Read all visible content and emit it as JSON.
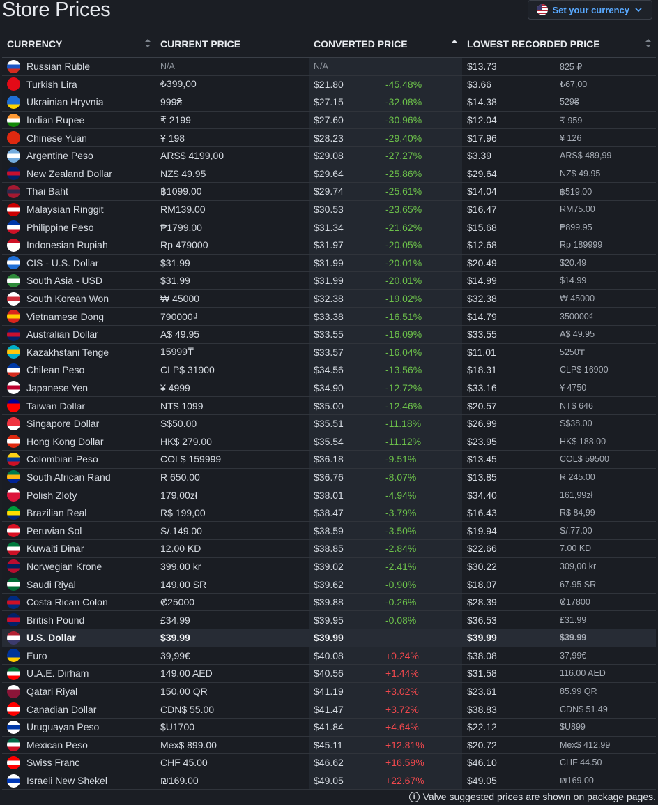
{
  "page": {
    "title": "Store Prices"
  },
  "currency_button": {
    "label": "Set your currency",
    "icon": "us-flag-icon"
  },
  "table": {
    "headers": [
      "CURRENCY",
      "CURRENT PRICE",
      "CONVERTED PRICE",
      "LOWEST RECORDED PRICE"
    ],
    "rows": [
      {
        "currency": "Russian Ruble",
        "current": "N/A",
        "converted": "N/A",
        "diff": "",
        "lowest": "$13.73",
        "lowest_local": "825 ₽",
        "flag": [
          "#ffffff",
          "#1c57c4",
          "#d52b1e"
        ]
      },
      {
        "currency": "Turkish Lira",
        "current": "₺399,00",
        "converted": "$21.80",
        "diff": "-45.48%",
        "lowest": "$3.66",
        "lowest_local": "₺67,00",
        "flag": [
          "#e30a17",
          "#e30a17",
          "#e30a17"
        ]
      },
      {
        "currency": "Ukrainian Hryvnia",
        "current": "999₴",
        "converted": "$27.15",
        "diff": "-32.08%",
        "lowest": "$14.38",
        "lowest_local": "529₴",
        "flag": [
          "#1f6fd6",
          "#1f6fd6",
          "#ffd500"
        ]
      },
      {
        "currency": "Indian Rupee",
        "current": "₹ 2199",
        "converted": "$27.60",
        "diff": "-30.96%",
        "lowest": "$12.04",
        "lowest_local": "₹ 959",
        "flag": [
          "#ff9933",
          "#ffffff",
          "#138808"
        ]
      },
      {
        "currency": "Chinese Yuan",
        "current": "¥ 198",
        "converted": "$28.23",
        "diff": "-29.40%",
        "lowest": "$17.96",
        "lowest_local": "¥ 126",
        "flag": [
          "#de2910",
          "#de2910",
          "#de2910"
        ]
      },
      {
        "currency": "Argentine Peso",
        "current": "ARS$ 4199,00",
        "converted": "$29.08",
        "diff": "-27.27%",
        "lowest": "$3.39",
        "lowest_local": "ARS$ 489,99",
        "flag": [
          "#74acdf",
          "#ffffff",
          "#74acdf"
        ]
      },
      {
        "currency": "New Zealand Dollar",
        "current": "NZ$ 49.95",
        "converted": "$29.64",
        "diff": "-25.86%",
        "lowest": "$29.64",
        "lowest_local": "NZ$ 49.95",
        "flag": [
          "#012169",
          "#c8102e",
          "#012169"
        ]
      },
      {
        "currency": "Thai Baht",
        "current": "฿1099.00",
        "converted": "$29.74",
        "diff": "-25.61%",
        "lowest": "$14.04",
        "lowest_local": "฿519.00",
        "flag": [
          "#a51931",
          "#2d2a4a",
          "#a51931"
        ]
      },
      {
        "currency": "Malaysian Ringgit",
        "current": "RM139.00",
        "converted": "$30.53",
        "diff": "-23.65%",
        "lowest": "$16.47",
        "lowest_local": "RM75.00",
        "flag": [
          "#cc0001",
          "#ffffff",
          "#cc0001"
        ]
      },
      {
        "currency": "Philippine Peso",
        "current": "₱1799.00",
        "converted": "$31.34",
        "diff": "-21.62%",
        "lowest": "$15.68",
        "lowest_local": "₱899.95",
        "flag": [
          "#0038a8",
          "#ffffff",
          "#ce1126"
        ]
      },
      {
        "currency": "Indonesian Rupiah",
        "current": "Rp 479000",
        "converted": "$31.97",
        "diff": "-20.05%",
        "lowest": "$12.68",
        "lowest_local": "Rp 189999",
        "flag": [
          "#ce1126",
          "#ffffff",
          "#ffffff"
        ]
      },
      {
        "currency": "CIS - U.S. Dollar",
        "current": "$31.99",
        "converted": "$31.99",
        "diff": "-20.01%",
        "lowest": "$20.49",
        "lowest_local": "$20.49",
        "flag": [
          "#1f6fd6",
          "#ffffff",
          "#1f6fd6"
        ]
      },
      {
        "currency": "South Asia - USD",
        "current": "$31.99",
        "converted": "$31.99",
        "diff": "-20.01%",
        "lowest": "$14.99",
        "lowest_local": "$14.99",
        "flag": [
          "#2e8b3a",
          "#ffffff",
          "#2e8b3a"
        ]
      },
      {
        "currency": "South Korean Won",
        "current": "₩ 45000",
        "converted": "$32.38",
        "diff": "-19.02%",
        "lowest": "$32.38",
        "lowest_local": "₩ 45000",
        "flag": [
          "#ffffff",
          "#cd2e3a",
          "#ffffff"
        ]
      },
      {
        "currency": "Vietnamese Dong",
        "current": "790000₫",
        "converted": "$33.38",
        "diff": "-16.51%",
        "lowest": "$14.79",
        "lowest_local": "350000₫",
        "flag": [
          "#da251d",
          "#ffcd00",
          "#da251d"
        ]
      },
      {
        "currency": "Australian Dollar",
        "current": "A$ 49.95",
        "converted": "$33.55",
        "diff": "-16.09%",
        "lowest": "$33.55",
        "lowest_local": "A$ 49.95",
        "flag": [
          "#012169",
          "#c8102e",
          "#012169"
        ]
      },
      {
        "currency": "Kazakhstani Tenge",
        "current": "15999₸",
        "converted": "$33.57",
        "diff": "-16.04%",
        "lowest": "$11.01",
        "lowest_local": "5250₸",
        "flag": [
          "#00afca",
          "#fec50c",
          "#00afca"
        ]
      },
      {
        "currency": "Chilean Peso",
        "current": "CLP$ 31900",
        "converted": "$34.56",
        "diff": "-13.56%",
        "lowest": "$18.31",
        "lowest_local": "CLP$ 16900",
        "flag": [
          "#0039a6",
          "#ffffff",
          "#d52b1e"
        ]
      },
      {
        "currency": "Japanese Yen",
        "current": "¥ 4999",
        "converted": "$34.90",
        "diff": "-12.72%",
        "lowest": "$33.16",
        "lowest_local": "¥ 4750",
        "flag": [
          "#ffffff",
          "#bc002d",
          "#ffffff"
        ]
      },
      {
        "currency": "Taiwan Dollar",
        "current": "NT$ 1099",
        "converted": "$35.00",
        "diff": "-12.46%",
        "lowest": "$20.57",
        "lowest_local": "NT$ 646",
        "flag": [
          "#000095",
          "#fe0000",
          "#fe0000"
        ]
      },
      {
        "currency": "Singapore Dollar",
        "current": "S$50.00",
        "converted": "$35.51",
        "diff": "-11.18%",
        "lowest": "$26.99",
        "lowest_local": "S$38.00",
        "flag": [
          "#ef3340",
          "#ef3340",
          "#ffffff"
        ]
      },
      {
        "currency": "Hong Kong Dollar",
        "current": "HK$ 279.00",
        "converted": "$35.54",
        "diff": "-11.12%",
        "lowest": "$23.95",
        "lowest_local": "HK$ 188.00",
        "flag": [
          "#de2910",
          "#ffffff",
          "#de2910"
        ]
      },
      {
        "currency": "Colombian Peso",
        "current": "COL$ 159999",
        "converted": "$36.18",
        "diff": "-9.51%",
        "lowest": "$13.45",
        "lowest_local": "COL$ 59500",
        "flag": [
          "#fcd116",
          "#003893",
          "#ce1126"
        ]
      },
      {
        "currency": "South African Rand",
        "current": "R 650.00",
        "converted": "$36.76",
        "diff": "-8.07%",
        "lowest": "$13.85",
        "lowest_local": "R 245.00",
        "flag": [
          "#007a4d",
          "#ffb612",
          "#002395"
        ]
      },
      {
        "currency": "Polish Zloty",
        "current": "179,00zł",
        "converted": "$38.01",
        "diff": "-4.94%",
        "lowest": "$34.40",
        "lowest_local": "161,99zł",
        "flag": [
          "#ffffff",
          "#dc143c",
          "#dc143c"
        ]
      },
      {
        "currency": "Brazilian Real",
        "current": "R$ 199,00",
        "converted": "$38.47",
        "diff": "-3.79%",
        "lowest": "$16.43",
        "lowest_local": "R$ 84,99",
        "flag": [
          "#009c3b",
          "#ffdf00",
          "#002776"
        ]
      },
      {
        "currency": "Peruvian Sol",
        "current": "S/.149.00",
        "converted": "$38.59",
        "diff": "-3.50%",
        "lowest": "$19.94",
        "lowest_local": "S/.77.00",
        "flag": [
          "#d91023",
          "#ffffff",
          "#d91023"
        ]
      },
      {
        "currency": "Kuwaiti Dinar",
        "current": "12.00 KD",
        "converted": "$38.85",
        "diff": "-2.84%",
        "lowest": "$22.66",
        "lowest_local": "7.00 KD",
        "flag": [
          "#007a3d",
          "#ffffff",
          "#ce1126"
        ]
      },
      {
        "currency": "Norwegian Krone",
        "current": "399,00 kr",
        "converted": "$39.02",
        "diff": "-2.41%",
        "lowest": "$30.22",
        "lowest_local": "309,00 kr",
        "flag": [
          "#ba0c2f",
          "#00205b",
          "#ba0c2f"
        ]
      },
      {
        "currency": "Saudi Riyal",
        "current": "149.00 SR",
        "converted": "$39.62",
        "diff": "-0.90%",
        "lowest": "$18.07",
        "lowest_local": "67.95 SR",
        "flag": [
          "#006c35",
          "#ffffff",
          "#006c35"
        ]
      },
      {
        "currency": "Costa Rican Colon",
        "current": "₡25000",
        "converted": "$39.88",
        "diff": "-0.26%",
        "lowest": "$28.39",
        "lowest_local": "₡17800",
        "flag": [
          "#002b7f",
          "#ce1126",
          "#002b7f"
        ]
      },
      {
        "currency": "British Pound",
        "current": "£34.99",
        "converted": "$39.95",
        "diff": "-0.08%",
        "lowest": "$36.53",
        "lowest_local": "£31.99",
        "flag": [
          "#012169",
          "#c8102e",
          "#012169"
        ]
      },
      {
        "currency": "U.S. Dollar",
        "current": "$39.99",
        "converted": "$39.99",
        "diff": "",
        "lowest": "$39.99",
        "lowest_local": "$39.99",
        "flag": [
          "#b22234",
          "#ffffff",
          "#3c3b6e"
        ],
        "highlight": true
      },
      {
        "currency": "Euro",
        "current": "39,99€",
        "converted": "$40.08",
        "diff": "+0.24%",
        "lowest": "$38.08",
        "lowest_local": "37,99€",
        "flag": [
          "#003399",
          "#003399",
          "#ffcc00"
        ]
      },
      {
        "currency": "U.A.E. Dirham",
        "current": "149.00 AED",
        "converted": "$40.56",
        "diff": "+1.44%",
        "lowest": "$31.58",
        "lowest_local": "116.00 AED",
        "flag": [
          "#00732f",
          "#ffffff",
          "#ff0000"
        ]
      },
      {
        "currency": "Qatari Riyal",
        "current": "150.00 QR",
        "converted": "$41.19",
        "diff": "+3.02%",
        "lowest": "$23.61",
        "lowest_local": "85.99 QR",
        "flag": [
          "#ffffff",
          "#8a1538",
          "#8a1538"
        ]
      },
      {
        "currency": "Canadian Dollar",
        "current": "CDN$ 55.00",
        "converted": "$41.47",
        "diff": "+3.72%",
        "lowest": "$38.83",
        "lowest_local": "CDN$ 51.49",
        "flag": [
          "#ff0000",
          "#ffffff",
          "#ff0000"
        ]
      },
      {
        "currency": "Uruguayan Peso",
        "current": "$U1700",
        "converted": "$41.84",
        "diff": "+4.64%",
        "lowest": "$22.12",
        "lowest_local": "$U899",
        "flag": [
          "#ffffff",
          "#0038a8",
          "#ffffff"
        ]
      },
      {
        "currency": "Mexican Peso",
        "current": "Mex$ 899.00",
        "converted": "$45.11",
        "diff": "+12.81%",
        "lowest": "$20.72",
        "lowest_local": "Mex$ 412.99",
        "flag": [
          "#006847",
          "#ffffff",
          "#ce1126"
        ]
      },
      {
        "currency": "Swiss Franc",
        "current": "CHF 45.00",
        "converted": "$46.62",
        "diff": "+16.59%",
        "lowest": "$46.10",
        "lowest_local": "CHF 44.50",
        "flag": [
          "#ff0000",
          "#ffffff",
          "#ff0000"
        ]
      },
      {
        "currency": "Israeli New Shekel",
        "current": "₪169.00",
        "converted": "$49.05",
        "diff": "+22.67%",
        "lowest": "$49.05",
        "lowest_local": "₪169.00",
        "flag": [
          "#ffffff",
          "#0038b8",
          "#ffffff"
        ]
      }
    ]
  },
  "footnote": {
    "text": "Valve suggested prices are shown on package pages.",
    "icon": "info-icon"
  },
  "colors": {
    "negative": "#6cc04a",
    "positive": "#f0484d",
    "accent": "#59a9ff",
    "background": "#1b1e24"
  }
}
